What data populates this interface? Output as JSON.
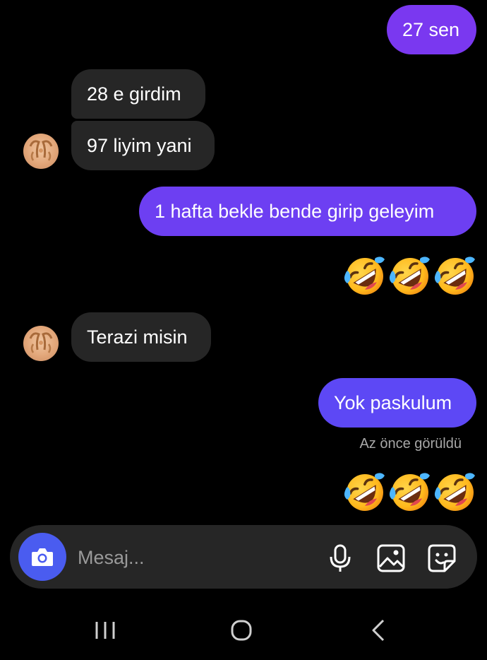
{
  "messages": {
    "m1": "27 sen",
    "m2": "28 e girdim",
    "m3": "97 liyim yani",
    "m4": "1 hafta bekle bende girip geleyim",
    "m5": "Terazi misin",
    "m6": "Yok paskulum"
  },
  "emoji_reaction": "rolling-on-floor-laughing",
  "seen_status": "Az önce görüldü",
  "composer": {
    "placeholder": "Mesaj..."
  },
  "icons": {
    "camera": "camera-icon",
    "mic": "microphone-icon",
    "gallery": "gallery-icon",
    "sticker": "sticker-icon",
    "recent_apps": "recent-apps-icon",
    "home": "home-icon",
    "back": "back-icon"
  },
  "colors": {
    "background": "#000000",
    "incoming_bubble": "#262626",
    "outgoing_bubble_top": "#7a38f0",
    "outgoing_bubble_bottom": "#5d48f5",
    "camera_button": "#4a5cf0"
  }
}
